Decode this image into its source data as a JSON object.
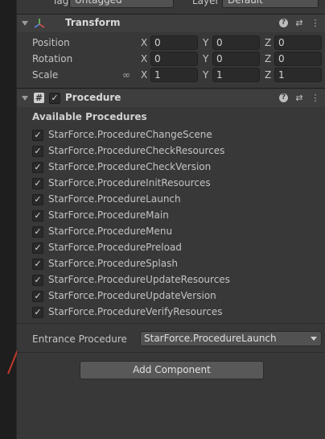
{
  "top_row": {
    "tag_label": "Tag",
    "tag_value": "Untagged",
    "layer_label": "Layer",
    "layer_value": "Default"
  },
  "transform": {
    "title": "Transform",
    "icon": "transform-gizmo-icon",
    "rows": [
      {
        "label": "Position",
        "x": "0",
        "y": "0",
        "z": "0"
      },
      {
        "label": "Rotation",
        "x": "0",
        "y": "0",
        "z": "0"
      },
      {
        "label": "Scale",
        "x": "1",
        "y": "1",
        "z": "1"
      }
    ],
    "axis_labels": [
      "X",
      "Y",
      "Z"
    ]
  },
  "procedure": {
    "title": "Procedure",
    "icon": "script-hash-icon",
    "enabled": true,
    "available_title": "Available Procedures",
    "items": [
      {
        "label": "StarForce.ProcedureChangeScene",
        "checked": true
      },
      {
        "label": "StarForce.ProcedureCheckResources",
        "checked": true
      },
      {
        "label": "StarForce.ProcedureCheckVersion",
        "checked": true
      },
      {
        "label": "StarForce.ProcedureInitResources",
        "checked": true
      },
      {
        "label": "StarForce.ProcedureLaunch",
        "checked": true
      },
      {
        "label": "StarForce.ProcedureMain",
        "checked": true
      },
      {
        "label": "StarForce.ProcedureMenu",
        "checked": true
      },
      {
        "label": "StarForce.ProcedurePreload",
        "checked": true
      },
      {
        "label": "StarForce.ProcedureSplash",
        "checked": true
      },
      {
        "label": "StarForce.ProcedureUpdateResources",
        "checked": true
      },
      {
        "label": "StarForce.ProcedureUpdateVersion",
        "checked": true
      },
      {
        "label": "StarForce.ProcedureVerifyResources",
        "checked": true
      }
    ],
    "entrance_label": "Entrance Procedure",
    "entrance_value": "StarForce.ProcedureLaunch"
  },
  "add_component_label": "Add Component",
  "glyphs": {
    "check": "✓",
    "help": "?",
    "settings": "⇄",
    "more": "⋮",
    "hash": "#",
    "link": "∞"
  },
  "colors": {
    "accent_arrow": "#c0392b",
    "panel_bg": "#383838",
    "header_bg": "#3e3e3e"
  }
}
